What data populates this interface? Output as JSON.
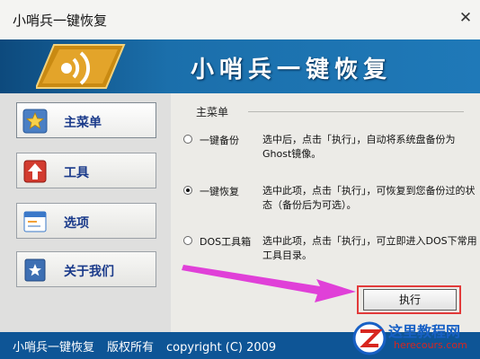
{
  "window": {
    "title": "小哨兵一键恢复"
  },
  "banner": {
    "title": "小哨兵一键恢复"
  },
  "sidebar": {
    "items": [
      {
        "label": "主菜单",
        "active": true
      },
      {
        "label": "工具"
      },
      {
        "label": "选项"
      },
      {
        "label": "关于我们"
      }
    ]
  },
  "main": {
    "group_title": "主菜单",
    "options": [
      {
        "label": "一键备份",
        "checked": false,
        "desc": "选中后，点击「执行」，自动将系统盘备份为Ghost镜像。"
      },
      {
        "label": "一键恢复",
        "checked": true,
        "desc": "选中此项，点击「执行」，可恢复到您备份过的状态（备份后为可选）。"
      },
      {
        "label": "DOS工具箱",
        "checked": false,
        "desc": "选中此项，点击「执行」，可立即进入DOS下常用工具目录。"
      }
    ],
    "execute_label": "执行"
  },
  "statusbar": {
    "app_name": "小哨兵一键恢复",
    "rights": "版权所有",
    "copyright": "copyright (C) 2009"
  },
  "watermark": {
    "text": "这里教程网",
    "url": "herecours.com"
  },
  "colors": {
    "banner": "#1b6fab",
    "statusbar": "#0e5596",
    "highlight": "#e23a3a",
    "arrow": "#e040d8",
    "sidebar_text": "#1a3a8a"
  }
}
